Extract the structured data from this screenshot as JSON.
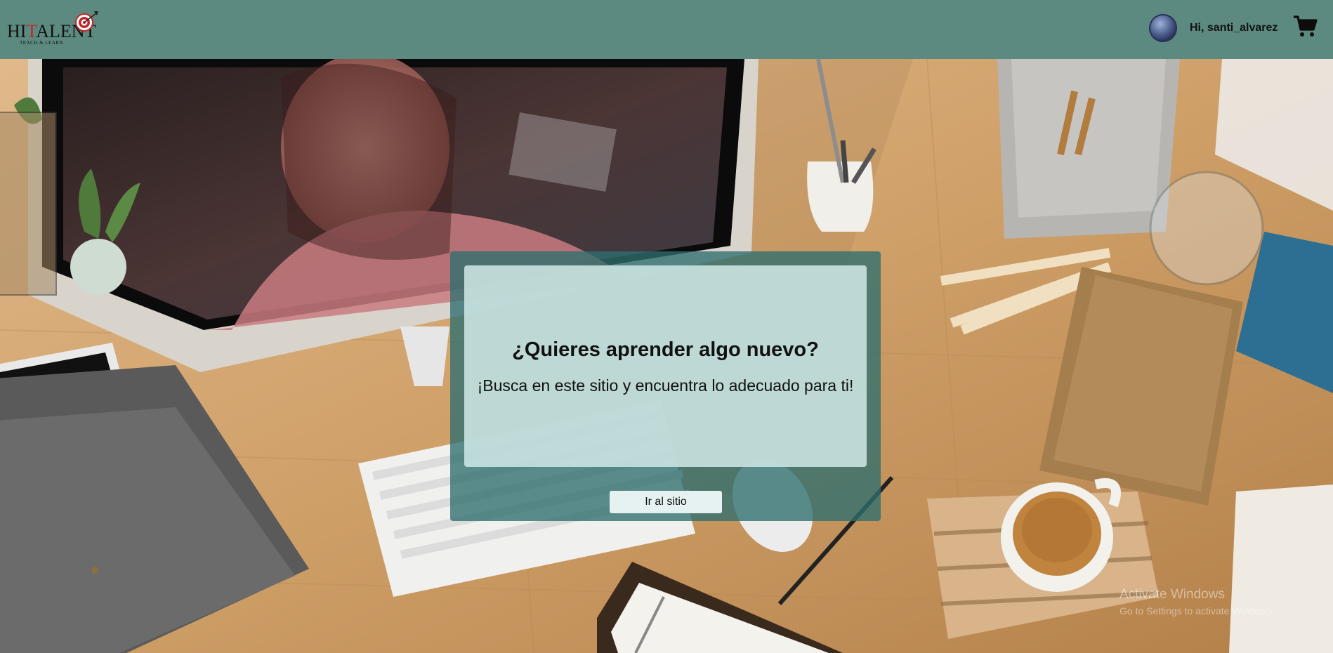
{
  "brand": {
    "logo_word_before": "HI",
    "logo_word_t": "T",
    "logo_word_after": "ALENT",
    "tagline": "TEACH & LEARN"
  },
  "header": {
    "greeting": "Hi, santi_alvarez",
    "avatar_icon": "avatar",
    "cart_icon": "shopping-cart-icon",
    "background_color": "#5d8a80"
  },
  "dialog": {
    "title": "¿Quieres aprender algo nuevo?",
    "subtitle": "¡Busca en este sitio y encuentra lo adecuado para ti!",
    "button_label": "Ir al sitio"
  },
  "watermark": {
    "title": "Activate Windows",
    "subtitle": "Go to Settings to activate Windows."
  }
}
